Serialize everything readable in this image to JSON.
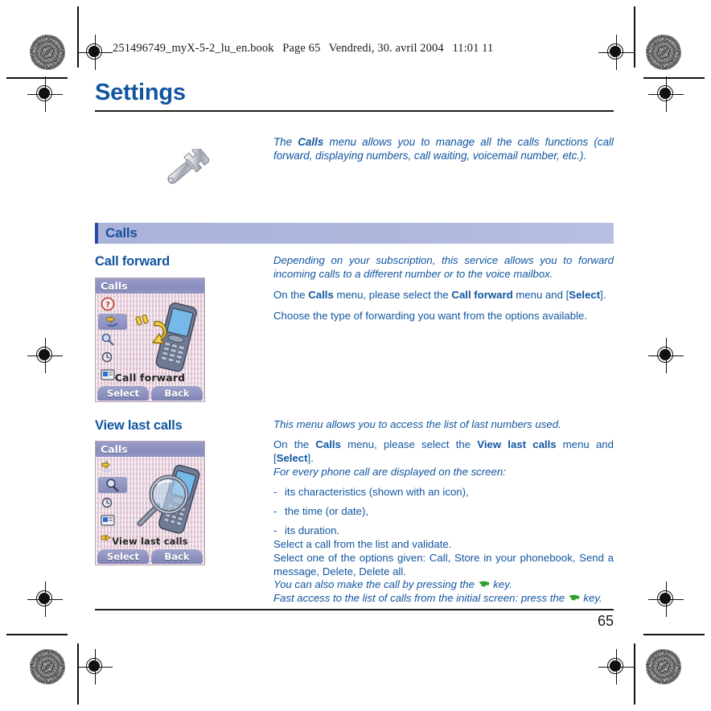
{
  "running_head": {
    "filename": "251496749_myX-5-2_lu_en.book",
    "page_label": "Page 65",
    "date": "Vendredi, 30. avril 2004",
    "time": "11:01 11"
  },
  "chapter": {
    "title": "Settings"
  },
  "intro": {
    "icon": "wrench-icon",
    "text_before": "The ",
    "bold": "Calls",
    "text_after": " menu allows you to manage all the calls functions (call forward, displaying numbers, call waiting, voicemail number, etc.)."
  },
  "section": {
    "label": "Calls"
  },
  "call_forward": {
    "heading": "Call forward",
    "intro": "Depending on your subscription, this service allows you to forward incoming calls to a different number or to the voice mailbox.",
    "step1_a": "On the ",
    "step1_b": "Calls",
    "step1_c": " menu, please select the ",
    "step1_d": "Call forward",
    "step1_e": " menu and [",
    "step1_f": "Select",
    "step1_g": "].",
    "step2": "Choose the type of forwarding you want from the options available.",
    "screenshot": {
      "title": "Calls",
      "label": "Call forward",
      "left_softkey": "Select",
      "right_softkey": "Back",
      "rail_icons": [
        "help-icon",
        "call-forward-icon",
        "view-last-calls-icon",
        "call-costs-icon",
        "caller-id-icon",
        "call-waiting-icon"
      ]
    }
  },
  "view_last_calls": {
    "heading": "View last calls",
    "intro": "This menu allows you to access the list of last numbers used.",
    "step1_a": "On the ",
    "step1_b": "Calls",
    "step1_c": " menu, please select the ",
    "step1_d": "View last calls",
    "step1_e": " menu and [",
    "step1_f": "Select",
    "step1_g": "].",
    "line_displayed": "For every phone call are displayed on the screen:",
    "bullets": [
      "its characteristics (shown with an icon),",
      "the time (or date),",
      "its duration."
    ],
    "bullet_dash": "-",
    "line_select": "Select a call from the list and validate.",
    "line_options": "Select one of the options given: Call, Store in your phonebook, Send a message, Delete, Delete all.",
    "line_makecall_a": "You can also make the call by pressing the ",
    "line_makecall_b": " key.",
    "line_fastaccess_a": "Fast access to the list of calls from the initial screen: press the ",
    "line_fastaccess_b": " key.",
    "screenshot": {
      "title": "Calls",
      "label": "View last calls",
      "left_softkey": "Select",
      "right_softkey": "Back",
      "rail_icons": [
        "call-forward-icon",
        "view-last-calls-icon",
        "call-costs-icon",
        "caller-id-icon",
        "call-waiting-icon",
        "divert-icon"
      ]
    }
  },
  "footer": {
    "page_number": "65"
  },
  "colors": {
    "heading_blue": "#11559e",
    "body_blue": "#1156a0",
    "section_bar_bg": "#aab3da",
    "section_bar_edge": "#2a4aa0",
    "phone_key_green": "#2ea02e"
  }
}
